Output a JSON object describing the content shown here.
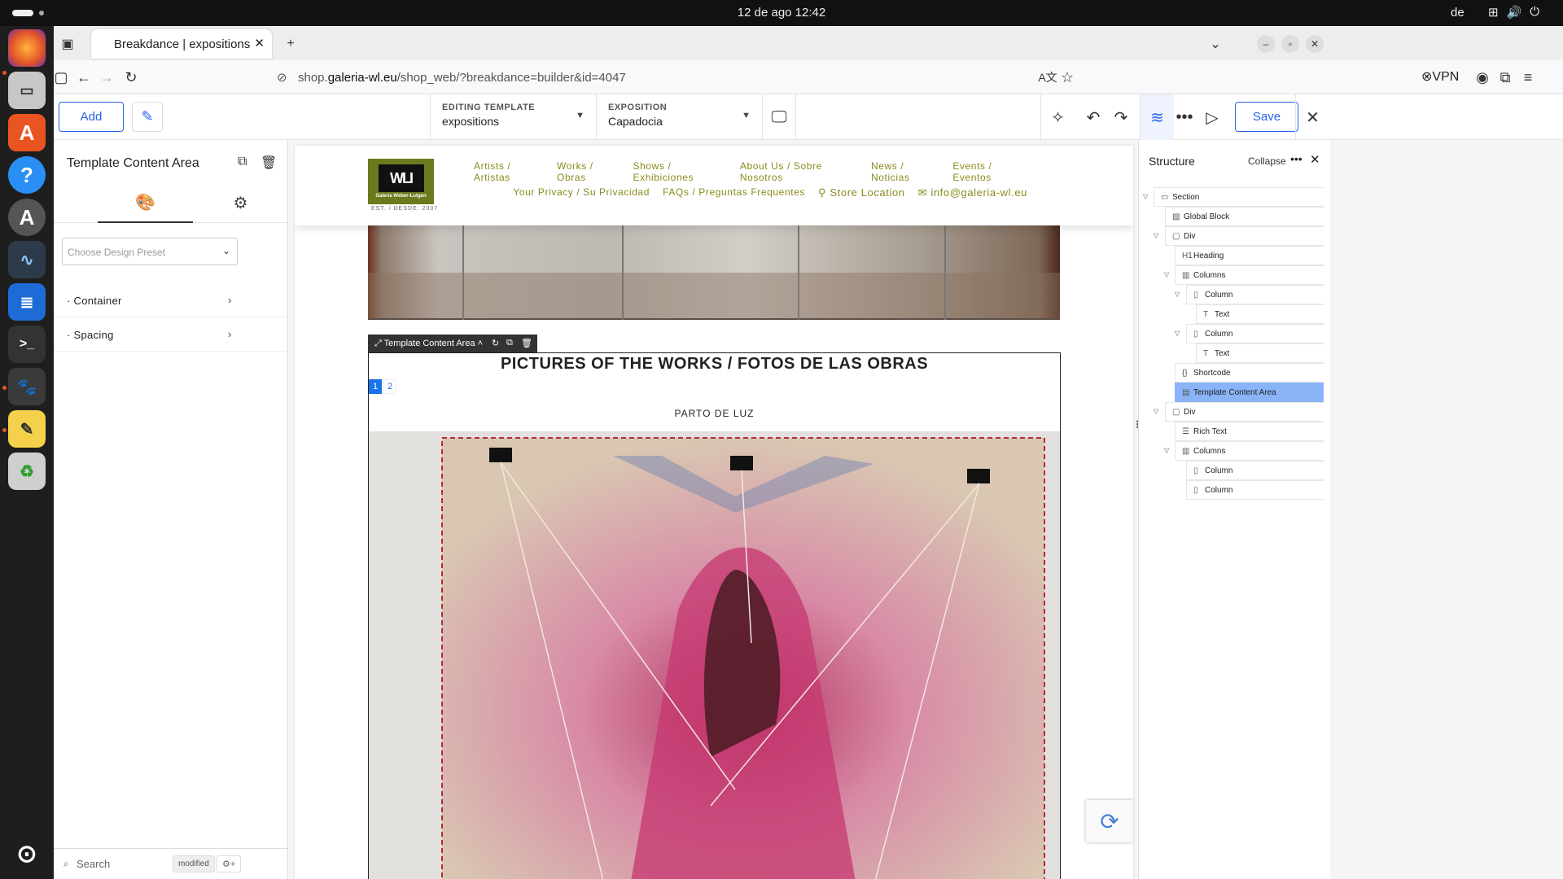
{
  "system": {
    "clock": "12 de ago  12:42",
    "language": "de"
  },
  "browser": {
    "tab_title": "Breakdance | expositions",
    "url_prefix": "shop.",
    "url_domain": "galeria-wl.eu",
    "url_path": "/shop_web/?breakdance=builder&id=4047",
    "vpn_label": "VPN"
  },
  "toolbar": {
    "add_label": "Add",
    "editing_template_label": "EDITING TEMPLATE",
    "editing_template_value": "expositions",
    "exposition_label": "EXPOSITION",
    "exposition_value": "Capadocia",
    "save_label": "Save"
  },
  "left_panel": {
    "title": "Template Content Area",
    "preset_placeholder": "Choose Design Preset",
    "sections": [
      "Container",
      "Spacing"
    ],
    "search_placeholder": "Search",
    "modified_badge": "modified"
  },
  "site": {
    "logo_text": "WLI",
    "logo_sub": "Galería Weber-Lutgen",
    "logo_est": "EST. / DESDE: 2007",
    "menu_row1": [
      "Artists / Artistas",
      "Works / Obras",
      "Shows / Exhibiciones",
      "About Us / Sobre Nosotros",
      "News / Noticias",
      "Events / Eventos"
    ],
    "menu_row2": [
      "Your Privacy / Su Privacidad",
      "FAQs / Preguntas Frequentes",
      "Store Location",
      "info@galeria-wl.eu"
    ],
    "tca_label": "Template Content Area",
    "works_title": "PICTURES OF THE WORKS / FOTOS DE LAS OBRAS",
    "pages": [
      "1",
      "2"
    ],
    "work_name": "PARTO DE LUZ"
  },
  "structure": {
    "title": "Structure",
    "collapse_label": "Collapse",
    "nodes": [
      {
        "label": "Section",
        "icon": "section-icon"
      },
      {
        "label": "Global Block",
        "icon": "global-block-icon"
      },
      {
        "label": "Div",
        "icon": "div-icon"
      },
      {
        "label": "Heading",
        "icon": "heading-icon"
      },
      {
        "label": "Columns",
        "icon": "columns-icon"
      },
      {
        "label": "Column",
        "icon": "column-icon"
      },
      {
        "label": "Text",
        "icon": "text-icon"
      },
      {
        "label": "Column",
        "icon": "column-icon"
      },
      {
        "label": "Text",
        "icon": "text-icon"
      },
      {
        "label": "Shortcode",
        "icon": "shortcode-icon"
      },
      {
        "label": "Template Content Area",
        "icon": "template-icon",
        "selected": true
      },
      {
        "label": "Div",
        "icon": "div-icon"
      },
      {
        "label": "Rich Text",
        "icon": "rich-text-icon"
      },
      {
        "label": "Columns",
        "icon": "columns-icon"
      },
      {
        "label": "Column",
        "icon": "column-icon"
      },
      {
        "label": "Column",
        "icon": "column-icon"
      }
    ]
  },
  "colors": {
    "accent": "#2563eb",
    "menu_olive": "#8a8a1c",
    "selected_node": "#8ab4f8"
  }
}
